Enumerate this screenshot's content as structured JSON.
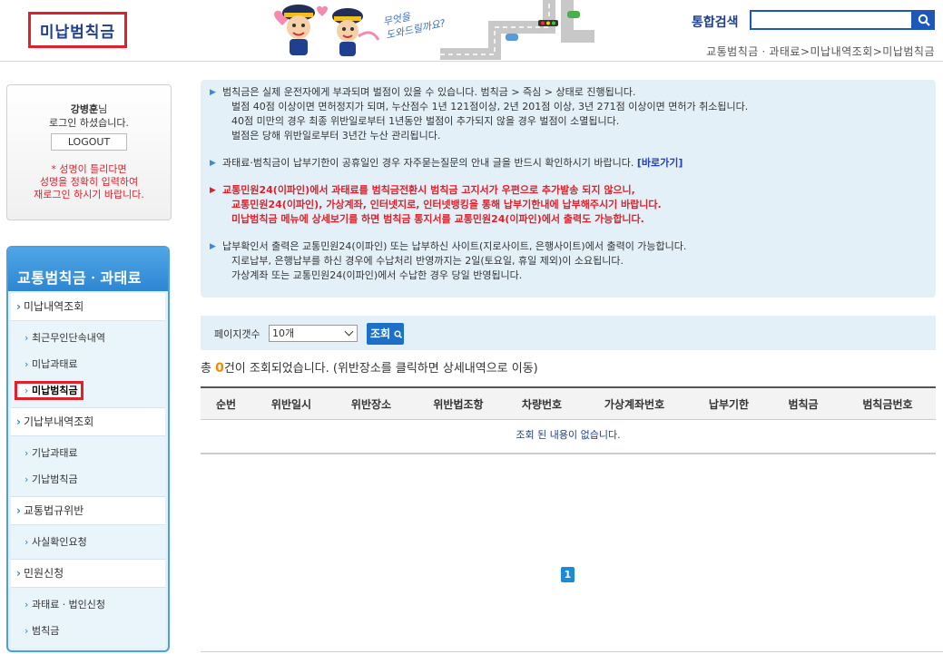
{
  "header": {
    "page_title": "미납범칙금",
    "banner_text_line1": "무엇을",
    "banner_text_line2": "도와드릴까요?",
    "search_label": "통합검색",
    "search_placeholder": "",
    "breadcrumb": "교통범칙금ㆍ과태료>미납내역조회>미납범칙금"
  },
  "login": {
    "user_name": "강병훈",
    "user_suffix": "님",
    "logged_in_text": "로그인 하셨습니다.",
    "logout_label": "LOGOUT",
    "warn_line1": "* 성명이 틀리다면",
    "warn_line2": "성명을 정확히 입력하여",
    "warn_line3": "재로그인 하시기 바랍니다."
  },
  "menu": {
    "title": "교통범칙금ㆍ과태료",
    "unpaid": "미납내역조회",
    "unpaid_items": [
      "최근무인단속내역",
      "미납과태료",
      "미납범칙금"
    ],
    "paid": "기납부내역조회",
    "paid_items": [
      "기납과태료",
      "기납범칙금"
    ],
    "violation": "교통법규위반",
    "violation_items": [
      "사실확인요청"
    ],
    "civil": "민원신청",
    "civil_items": [
      "과태료ㆍ법인신청",
      "범칙금"
    ]
  },
  "notice": {
    "p1": [
      "범칙금은 실제 운전자에게 부과되며 벌점이 있을 수 있습니다. 범칙금 > 즉심 > 상태로 진행됩니다.",
      "벌점 40점 이상이면 면허정지가 되며, 누산점수 1년 121점이상, 2년 201점 이상, 3년 271점 이상이면 면허가 취소됩니다.",
      "40점 미만의 경우 최종 위반일로부터 1년동안 벌점이 추가되지 않을 경우 벌점이 소멸됩니다.",
      "벌점은 당해 위반일로부터 3년간 누산 관리됩니다."
    ],
    "p2": "과태료·범칙금이 납부기한이 공휴일인 경우 자주묻는질문의 안내 글을 반드시 확인하시기 바랍니다.",
    "p2_link": "[바로가기]",
    "p3": [
      "교통민원24(이파인)에서 과태료를 범칙금전환시 범칙금 고지서가 우편으로 추가발송 되지 않으니,",
      "교통민원24(이파인), 가상계좌, 인터넷지로, 인터넷뱅킹을 통해 납부기한내에 납부해주시기 바랍니다.",
      "미납범칙금 메뉴에 상세보기를 하면 범칙금 통지서를 교통민원24(이파인)에서 출력도 가능합니다."
    ],
    "p4": [
      "납부확인서 출력은 교통민원24(이파인) 또는 납부하신 사이트(지로사이트, 은행사이트)에서 출력이 가능합니다.",
      "지로납부, 은행납부를 하신 경우에 수납처리 반영까지는 2일(토요일, 휴일 제외)이 소요됩니다.",
      "가상계좌 또는 교통민원24(이파인)에서 수납한 경우 당일 반영됩니다."
    ]
  },
  "filter": {
    "label": "페이지갯수",
    "selected": "10개",
    "button": "조회"
  },
  "result": {
    "prefix": "총 ",
    "count": "0",
    "suffix": "건이 조회되었습니다. (위반장소를 클릭하면 상세내역으로 이동)"
  },
  "table": {
    "columns": [
      "순번",
      "위반일시",
      "위반장소",
      "위반법조항",
      "차량번호",
      "가상계좌번호",
      "납부기한",
      "범칙금",
      "범칙금번호"
    ],
    "empty_message": "조회 된 내용이 없습니다."
  },
  "pagination": {
    "current": "1"
  },
  "colors": {
    "accent_blue": "#1d58b8",
    "highlight_red": "#e0202a",
    "count_orange": "#f08a00"
  }
}
